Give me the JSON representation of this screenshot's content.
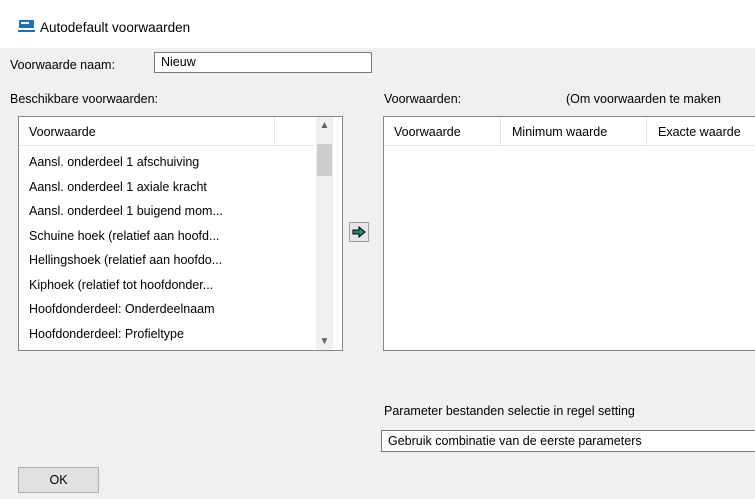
{
  "window": {
    "title": "Autodefault voorwaarden",
    "icon": "app-icon"
  },
  "name_field": {
    "label": "Voorwaarde naam:",
    "value": "Nieuw"
  },
  "available": {
    "label": "Beschikbare voorwaarden:",
    "header": "Voorwaarde",
    "items": [
      "Aansl. onderdeel 1 afschuiving",
      "Aansl. onderdeel 1 axiale kracht",
      "Aansl. onderdeel 1 buigend mom...",
      "Schuine hoek (relatief aan hoofd...",
      "Hellingshoek (relatief aan hoofdo...",
      "Kiphoek (relatief tot hoofdonder...",
      "Hoofdonderdeel: Onderdeelnaam",
      "Hoofdonderdeel: Profieltype"
    ]
  },
  "move_button": {
    "icon": "arrow-right-icon",
    "color": "#1e8f7a"
  },
  "conditions": {
    "label": "Voorwaarden:",
    "hint": "(Om voorwaarden te maken",
    "columns": [
      "Voorwaarde",
      "Minimum waarde",
      "Exacte waarde"
    ]
  },
  "parameters": {
    "label": "Parameter bestanden selectie in regel setting",
    "selected": "Gebruik combinatie van de eerste parameters"
  },
  "ok_button": {
    "label": "OK"
  }
}
